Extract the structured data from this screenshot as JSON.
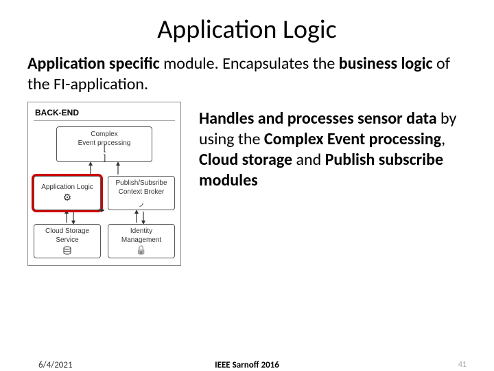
{
  "title": "Application Logic",
  "intro": {
    "t1": "Application specific",
    "t2": " module. Encapsulates the ",
    "t3": "business logic",
    "t4": " of the FI-application."
  },
  "body": {
    "b1": "Handles and processes sensor data",
    "b2": " by using the ",
    "b3": "Complex Event processing",
    "b4": ", ",
    "b5": "Cloud storage",
    "b6": " and ",
    "b7": "Publish subscribe modules"
  },
  "diagram": {
    "section": "BACK-END",
    "boxes": {
      "complex_l1": "Complex",
      "complex_l2": "Event processing",
      "applogic": "Application Logic",
      "pubsub_l1": "Publish/Subsribe",
      "pubsub_l2": "Context Broker",
      "cloud_l1": "Cloud Storage",
      "cloud_l2": "Service",
      "ident_l1": "Identity",
      "ident_l2": "Management"
    }
  },
  "footer": {
    "date": "6/4/2021",
    "mid": "IEEE Sarnoff 2016",
    "page": "41"
  }
}
